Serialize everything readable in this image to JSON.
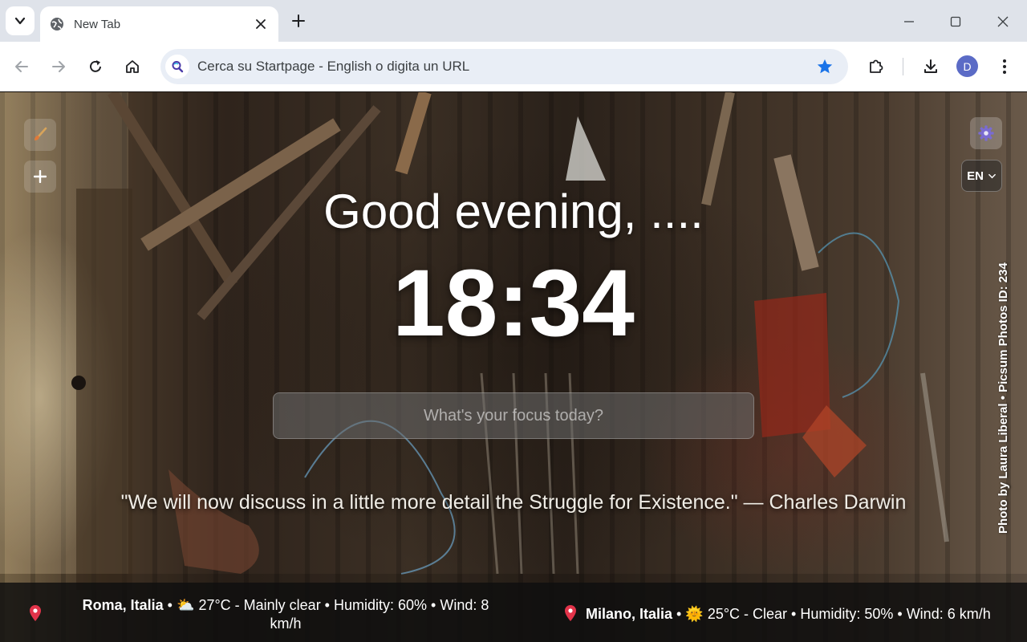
{
  "browser": {
    "tab": {
      "title": "New Tab"
    },
    "omnibox": {
      "text": "Cerca su Startpage - English o digita un URL"
    },
    "profile": {
      "initial": "D"
    }
  },
  "page": {
    "greeting": "Good evening, ....",
    "clock": "18:34",
    "focus": {
      "placeholder": "What's your focus today?"
    },
    "quote": "\"We will now discuss in a little more detail the Struggle for Existence.\" — Charles Darwin",
    "photo_credit": "Photo by Laura Liberal • Picsum Photos ID: 234",
    "language": {
      "selected": "EN"
    },
    "weather": [
      {
        "city": "Roma, Italia",
        "separator": "•",
        "icon": "⛅",
        "details": "27°C - Mainly clear • Humidity: 60% • Wind: 8 km/h"
      },
      {
        "city": "Milano, Italia",
        "separator": "•",
        "icon": "🌞",
        "details": "25°C - Clear • Humidity: 50% • Wind: 6 km/h"
      }
    ]
  },
  "icons": {
    "tab_search": "chevron-down-icon",
    "favicon": "globe-icon",
    "close": "close-icon",
    "new_tab": "plus-icon",
    "back": "arrow-left-icon",
    "forward": "arrow-right-icon",
    "reload": "reload-icon",
    "home": "home-icon",
    "search_engine": "search-icon",
    "bookmark": "star-icon",
    "extensions": "puzzle-icon",
    "downloads": "download-icon",
    "menu": "kebab-menu-icon",
    "theme": "brush-icon",
    "add": "plus-icon",
    "settings": "gear-icon",
    "location": "pin-icon"
  },
  "colors": {
    "accent": "#1a73e8",
    "pin": "#e2344a"
  }
}
